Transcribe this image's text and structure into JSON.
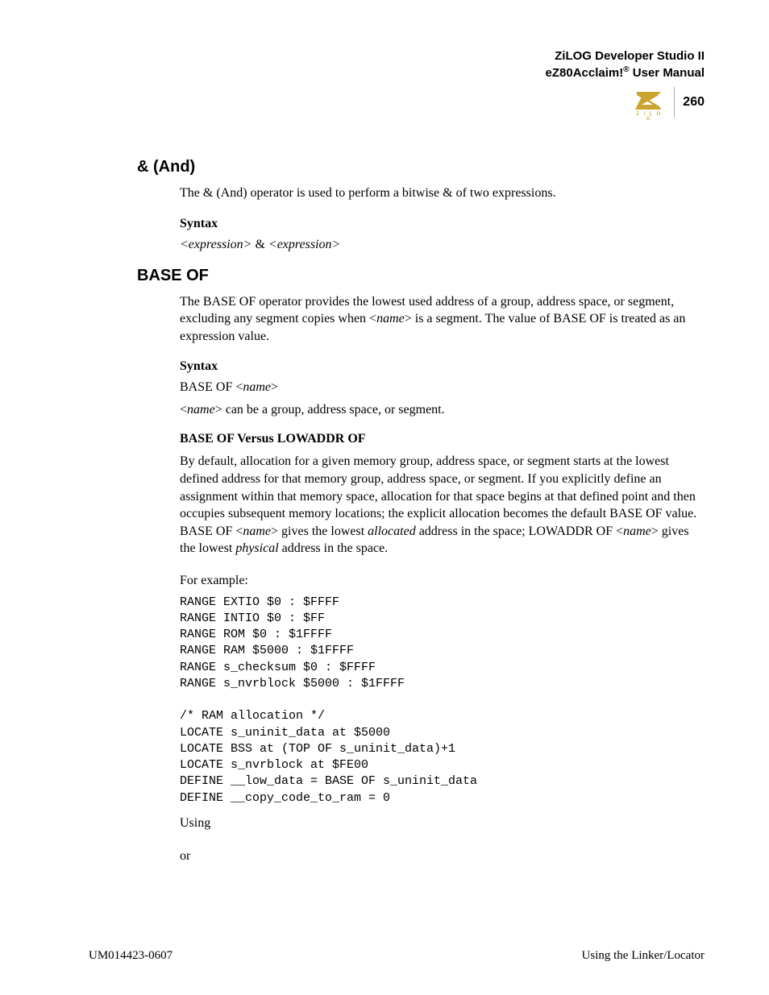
{
  "header": {
    "line1": "ZiLOG Developer Studio II",
    "line2_pre": "eZ80Acclaim!",
    "line2_sup": "®",
    "line2_post": " User Manual"
  },
  "logo_caption": "Z i L O G",
  "page_number": "260",
  "sections": {
    "and": {
      "title": "& (And)",
      "intro": "The & (And) operator is used to perform a bitwise & of two expressions.",
      "syntax_head": "Syntax",
      "syntax_expr_left": "<expression>",
      "syntax_amp": " & ",
      "syntax_expr_right": "<expression>"
    },
    "baseof": {
      "title": "BASE OF",
      "intro_pre": "The BASE OF operator provides the lowest used address of a group, address space, or segment, excluding any segment copies when <",
      "intro_name": "name",
      "intro_post": "> is a segment. The value of BASE OF is treated as an expression value.",
      "syntax_head": "Syntax",
      "syntax_line_pre": "BASE OF <",
      "syntax_line_name": "name",
      "syntax_line_post": ">",
      "syntax_note_pre": "<",
      "syntax_note_name": "name",
      "syntax_note_post": "> can be a group, address space, or segment.",
      "versus_head": "BASE OF Versus LOWADDR OF",
      "versus_p1_a": "By default, allocation for a given memory group, address space, or segment starts at the lowest defined address for that memory group, address space, or segment. If you explicitly define an assignment within that memory space, allocation for that space begins at that defined point and then occupies subsequent memory locations; the explicit allocation becomes the default BASE OF value. BASE OF <",
      "versus_p1_name1": "name",
      "versus_p1_b": "> gives the lowest ",
      "versus_p1_alloc": "allocated",
      "versus_p1_c": " address in the space; LOWADDR OF <",
      "versus_p1_name2": "name",
      "versus_p1_d": "> gives the lowest ",
      "versus_p1_phys": "physical",
      "versus_p1_e": " address in the space.",
      "for_example": "For example:",
      "code": "RANGE EXTIO $0 : $FFFF\nRANGE INTIO $0 : $FF\nRANGE ROM $0 : $1FFFF\nRANGE RAM $5000 : $1FFFF\nRANGE s_checksum $0 : $FFFF\nRANGE s_nvrblock $5000 : $1FFFF\n\n/* RAM allocation */\nLOCATE s_uninit_data at $5000\nLOCATE BSS at (TOP OF s_uninit_data)+1\nLOCATE s_nvrblock at $FE00\nDEFINE __low_data = BASE OF s_uninit_data\nDEFINE __copy_code_to_ram = 0",
      "using": "Using",
      "or": "or"
    }
  },
  "footer": {
    "left": "UM014423-0607",
    "right": "Using the Linker/Locator"
  }
}
